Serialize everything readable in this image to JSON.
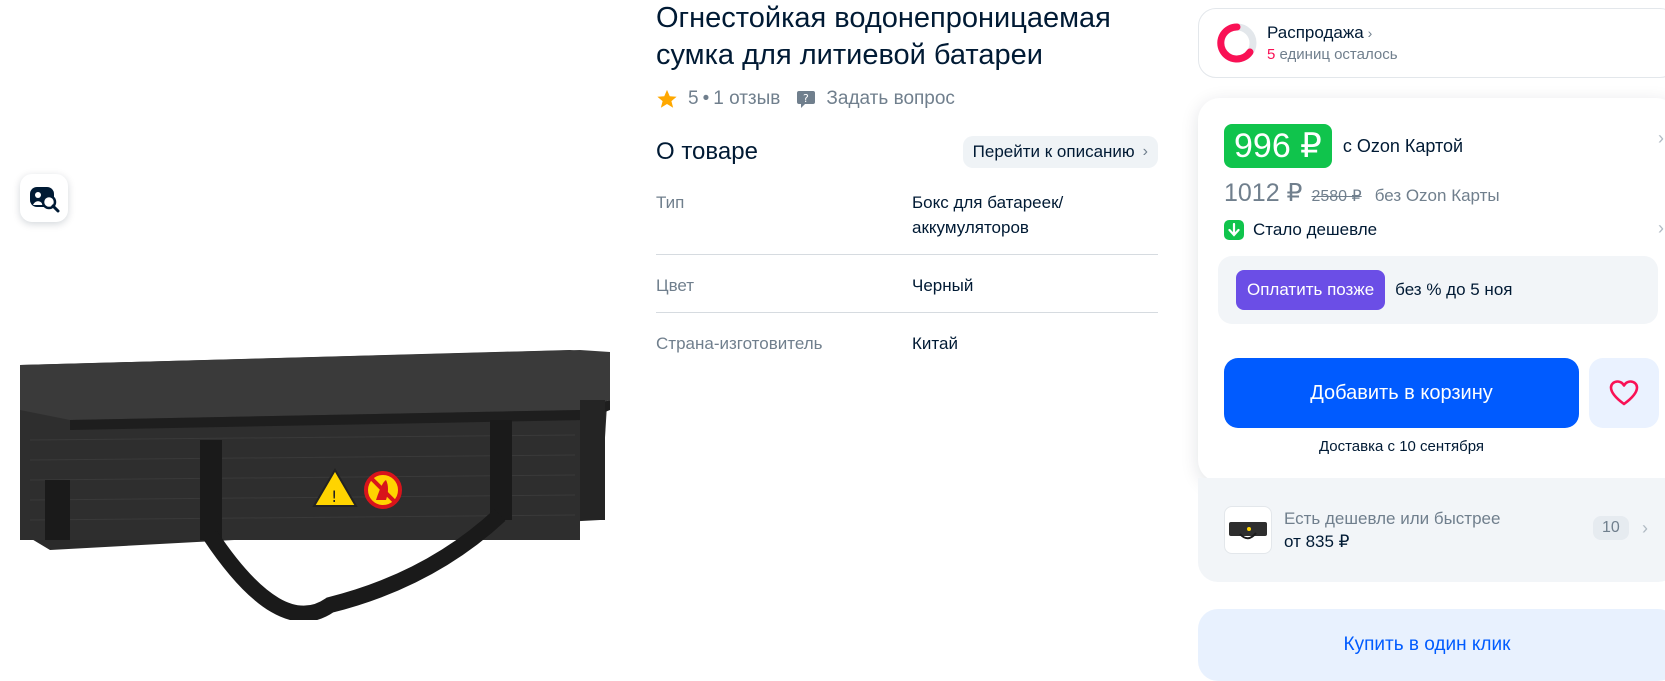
{
  "product": {
    "title_line1": "Огнестойкая водонепроницаемая",
    "title_line2": "сумка для литиевой батареи",
    "rating": "5",
    "rating_separator": "•",
    "reviews": "1 отзыв",
    "ask_question": "Задать вопрос"
  },
  "about": {
    "heading": "О товаре",
    "goto_description": "Перейти к описанию",
    "specs": [
      {
        "key": "Тип",
        "value": "Бокс для батареек/аккумуляторов"
      },
      {
        "key": "Цвет",
        "value": "Черный"
      },
      {
        "key": "Страна-изготовитель",
        "value": "Китай"
      }
    ]
  },
  "sale": {
    "title": "Распродажа",
    "count": "5",
    "count_text": "единиц осталось"
  },
  "price": {
    "card_price": "996 ₽",
    "card_label": "с Ozon Картой",
    "regular_price": "1012 ₽",
    "old_price": "2580 ₽",
    "regular_label": "без Ozon Карты",
    "cheaper_label": "Стало дешевле",
    "pay_later_button": "Оплатить позже",
    "pay_later_text": "без % до 5 ноя",
    "add_to_cart": "Добавить в корзину",
    "delivery": "Доставка с 10 сентября"
  },
  "alternatives": {
    "line1": "Есть дешевле или быстрее",
    "line2": "от 835 ₽",
    "count": "10"
  },
  "one_click": "Купить в один клик",
  "colors": {
    "accent_blue": "#005bff",
    "price_green": "#10c44c",
    "pay_later_purple": "#6b4ee6",
    "sale_pink": "#f91155",
    "star_orange": "#ffa800"
  },
  "icons": {
    "visual_search": "camera-search-icon",
    "rating": "star-icon",
    "question": "chat-question-icon",
    "sale": "sale-ring-icon",
    "cheaper": "arrow-down-icon",
    "favorite": "heart-icon"
  }
}
